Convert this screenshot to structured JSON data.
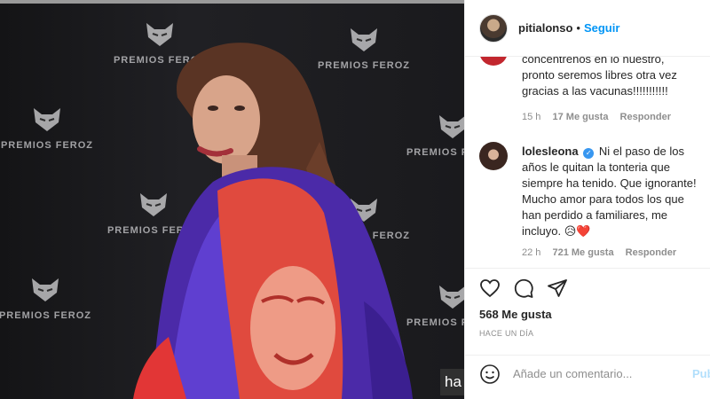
{
  "photo": {
    "brand_text": "PREMIOS FEROZ",
    "caption_fragment": "ha"
  },
  "header": {
    "username": "pitialonso",
    "separator": "•",
    "follow_label": "Seguir"
  },
  "comments": [
    {
      "text": "concentrenos en lo nuestro, pronto seremos libres otra vez gracias a las vacunas!!!!!!!!!!!",
      "time": "15 h",
      "likes": "17 Me gusta",
      "reply": "Responder"
    },
    {
      "username": "lolesleona",
      "text": "Ni el paso de los años le quitan la tonteria que siempre ha tenido. Que ignorante! Mucho amor para todos los que han perdido a familiares, me incluyo. 😥❤️",
      "time": "22 h",
      "likes": "721 Me gusta",
      "reply": "Responder"
    }
  ],
  "actions": {
    "likes": "568 Me gusta",
    "posted_ago": "HACE UN DÍA"
  },
  "add_comment": {
    "placeholder": "Añade un comentario...",
    "publish_label": "Publ"
  },
  "icons": [
    "heart-icon",
    "comment-icon",
    "share-icon",
    "emoji-icon",
    "verified-badge-icon"
  ],
  "colors": {
    "accent": "#0095f6",
    "verified": "#3897f0",
    "muted": "#8e8e8e"
  }
}
